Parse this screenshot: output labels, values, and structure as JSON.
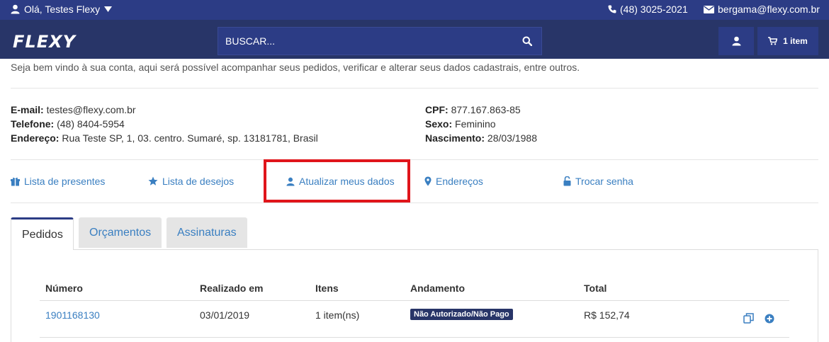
{
  "topbar": {
    "greeting": "Olá, Testes Flexy",
    "phone": "(48) 3025-2021",
    "email": "bergama@flexy.com.br"
  },
  "navbar": {
    "logo": "FLEXY",
    "search_placeholder": "BUSCAR...",
    "cart_label": "1 item"
  },
  "welcome": "Seja bem vindo à sua conta, aqui será possível acompanhar seus pedidos, verificar e alterar seus dados cadastrais, entre outros.",
  "profile": {
    "email_label": "E-mail:",
    "email_value": "testes@flexy.com.br",
    "phone_label": "Telefone:",
    "phone_value": "(48) 8404-5954",
    "address_label": "Endereço:",
    "address_value": "Rua Teste SP, 1, 03. centro. Sumaré, sp. 13181781, Brasil",
    "cpf_label": "CPF:",
    "cpf_value": "877.167.863-85",
    "sex_label": "Sexo:",
    "sex_value": "Feminino",
    "birth_label": "Nascimento:",
    "birth_value": "28/03/1988"
  },
  "account_links": {
    "gift_list": "Lista de presentes",
    "wish_list": "Lista de desejos",
    "update_data": "Atualizar meus dados",
    "addresses": "Endereços",
    "change_password": "Trocar senha"
  },
  "tabs": {
    "orders": "Pedidos",
    "quotes": "Orçamentos",
    "subscriptions": "Assinaturas"
  },
  "orders_table": {
    "headers": {
      "number": "Número",
      "date": "Realizado em",
      "items": "Itens",
      "status": "Andamento",
      "total": "Total"
    },
    "rows": [
      {
        "number": "1901168130",
        "date": "03/01/2019",
        "items": "1 item(ns)",
        "status": "Não Autorizado/Não Pago",
        "total": "R$ 152,74"
      }
    ]
  },
  "colors": {
    "topbar": "#2c3c85",
    "navbar": "#283568",
    "link": "#3a7fc1",
    "highlight": "#e0151b"
  }
}
